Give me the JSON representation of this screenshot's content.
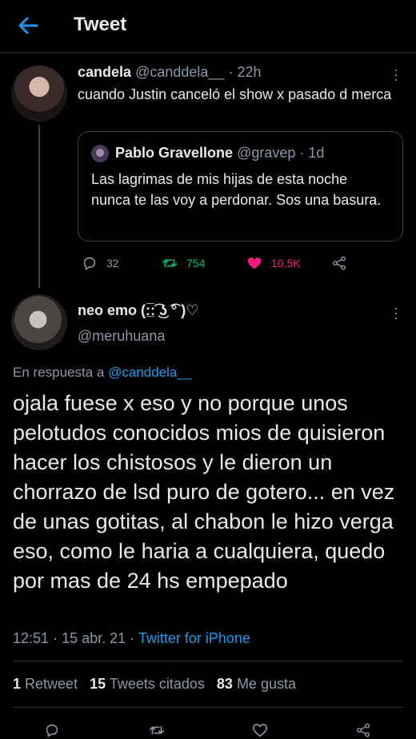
{
  "header": {
    "title": "Tweet"
  },
  "tweet1": {
    "name": "candela",
    "handle": "@canddela__",
    "time": "22h",
    "text": "cuando Justin canceló el show x pasado d merca",
    "quote": {
      "name": "Pablo Gravellone",
      "handle": "@gravep",
      "time": "1d",
      "text": "Las lagrimas de mis hijas de esta noche nunca te las voy a perdonar. Sos una basura."
    },
    "replies": "32",
    "retweets": "754",
    "likes": "10.5K"
  },
  "tweet2": {
    "name": "neo emo (:̲̅:͡ ͜ʖ ͡° )♡",
    "handle": "@meruhuana",
    "reply_prefix": "En respuesta a",
    "reply_to": "@canddela__",
    "text": "ojala fuese x eso y no porque unos pelotudos conocidos mios de quisieron hacer los chistosos y le dieron un chorrazo de lsd puro de gotero... en vez de unas gotitas, al chabon le hizo verga eso, como le haria a cualquiera, quedo por mas de 24 hs empepado",
    "time": "12:51",
    "date": "15 abr. 21",
    "source": "Twitter for iPhone",
    "stats": {
      "retweets_count": "1",
      "retweets_label": "Retweet",
      "quotes_count": "15",
      "quotes_label": "Tweets citados",
      "likes_count": "83",
      "likes_label": "Me gusta"
    }
  },
  "colors": {
    "background": "#000000",
    "accent": "#1d9bf0",
    "retweet": "#00ba7c",
    "like": "#f91880",
    "muted": "#8b98a5"
  },
  "icons": [
    "back-arrow-icon",
    "more-icon",
    "reply-icon",
    "retweet-icon",
    "heart-icon",
    "share-icon"
  ]
}
